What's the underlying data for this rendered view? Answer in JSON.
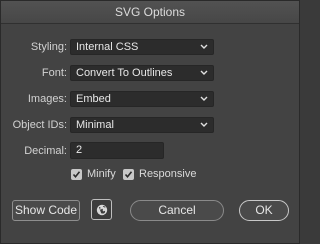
{
  "window": {
    "title": "SVG Options"
  },
  "fields": {
    "styling": {
      "label": "Styling:",
      "value": "Internal CSS"
    },
    "font": {
      "label": "Font:",
      "value": "Convert To Outlines"
    },
    "images": {
      "label": "Images:",
      "value": "Embed"
    },
    "object_ids": {
      "label": "Object IDs:",
      "value": "Minimal"
    },
    "decimal": {
      "label": "Decimal:",
      "value": "2"
    }
  },
  "checkboxes": {
    "minify": {
      "label": "Minify",
      "checked": true
    },
    "responsive": {
      "label": "Responsive",
      "checked": true
    }
  },
  "buttons": {
    "show_code": "Show Code",
    "globe_icon": "globe-icon",
    "cancel": "Cancel",
    "ok": "OK"
  }
}
